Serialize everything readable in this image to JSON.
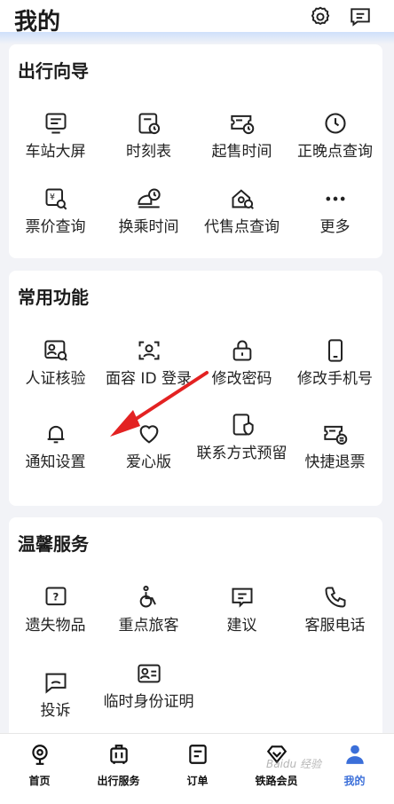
{
  "header": {
    "title": "我的",
    "settings_icon": "gear-icon",
    "message_icon": "message-icon"
  },
  "sections": [
    {
      "title": "出行向导",
      "items": [
        {
          "label": "车站大屏",
          "icon": "screen-icon"
        },
        {
          "label": "时刻表",
          "icon": "timetable-icon"
        },
        {
          "label": "起售时间",
          "icon": "ticket-time-icon"
        },
        {
          "label": "正晚点查询",
          "icon": "clock-icon"
        },
        {
          "label": "票价查询",
          "icon": "price-search-icon"
        },
        {
          "label": "换乘时间",
          "icon": "train-clock-icon"
        },
        {
          "label": "代售点查询",
          "icon": "agency-search-icon"
        },
        {
          "label": "更多",
          "icon": "more-icon"
        }
      ]
    },
    {
      "title": "常用功能",
      "items": [
        {
          "label": "人证核验",
          "icon": "id-verify-icon"
        },
        {
          "label": "面容 ID 登录",
          "icon": "face-id-icon"
        },
        {
          "label": "修改密码",
          "icon": "lock-icon"
        },
        {
          "label": "修改手机号",
          "icon": "phone-icon"
        },
        {
          "label": "通知设置",
          "icon": "bell-icon"
        },
        {
          "label": "爱心版",
          "icon": "heart-icon"
        },
        {
          "label": "联系方式预留",
          "icon": "contact-shield-icon"
        },
        {
          "label": "快捷退票",
          "icon": "refund-icon"
        }
      ]
    },
    {
      "title": "温馨服务",
      "items": [
        {
          "label": "遗失物品",
          "icon": "lost-item-icon"
        },
        {
          "label": "重点旅客",
          "icon": "wheelchair-icon"
        },
        {
          "label": "建议",
          "icon": "suggestion-icon"
        },
        {
          "label": "客服电话",
          "icon": "phone-call-icon"
        },
        {
          "label": "投诉",
          "icon": "complaint-icon"
        },
        {
          "label": "临时身份证明",
          "icon": "id-card-icon"
        }
      ]
    }
  ],
  "tabbar": [
    {
      "label": "首页",
      "icon": "home-icon"
    },
    {
      "label": "出行服务",
      "icon": "luggage-icon"
    },
    {
      "label": "订单",
      "icon": "order-icon"
    },
    {
      "label": "铁路会员",
      "icon": "diamond-icon"
    },
    {
      "label": "我的",
      "icon": "person-icon",
      "active": true
    }
  ],
  "watermark": "Baidu 经验",
  "colors": {
    "accent": "#3b6fd9",
    "arrow": "#e32222"
  }
}
